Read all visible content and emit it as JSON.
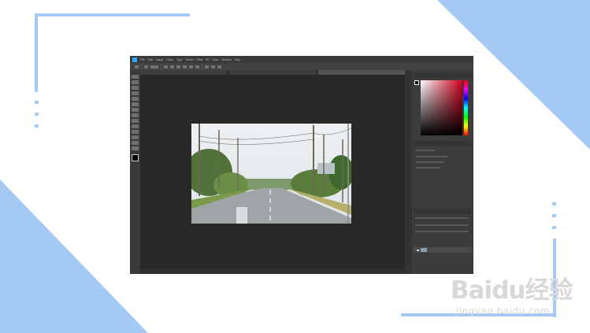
{
  "slide": {
    "accent_color": "#a5c9f5",
    "background_color": "#ffffff"
  },
  "photoshop": {
    "app_icon": "photoshop-logo-icon",
    "menu": [
      "File",
      "Edit",
      "Image",
      "Layer",
      "Type",
      "Select",
      "Filter",
      "3D",
      "View",
      "Window",
      "Help"
    ],
    "tabs": [
      {
        "label": "",
        "active": false
      },
      {
        "label": "",
        "active": false
      },
      {
        "label": "",
        "active": true
      }
    ],
    "status_text": "",
    "panels": {
      "color_tabs": [
        "",
        ""
      ],
      "properties_tabs": [
        "",
        ""
      ],
      "layers_tabs": [
        "",
        "",
        ""
      ],
      "layer_name": ""
    },
    "picker_color": "#d4001f"
  },
  "watermark": {
    "logo": "Bai",
    "logo_cn": "du经验",
    "url": "jingyan.baidu.com"
  }
}
